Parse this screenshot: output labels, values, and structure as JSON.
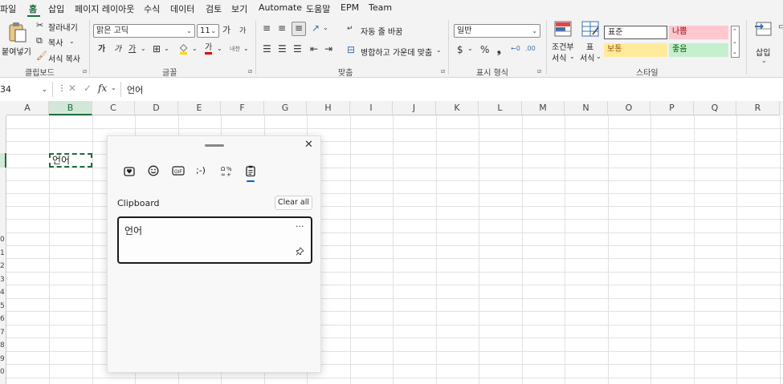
{
  "menu": {
    "file": "파일",
    "home": "홈",
    "insert": "삽입",
    "layout": "페이지 레이아웃",
    "formulas": "수식",
    "data": "데이터",
    "review": "검토",
    "view": "보기",
    "automate": "Automate",
    "help": "도움말",
    "epm": "EPM",
    "team": "Team"
  },
  "ribbon": {
    "clipboard": {
      "paste": "붙여넣기",
      "cut": "잘라내기",
      "copy": "복사",
      "format_painter": "서식 복사",
      "label": "클립보드"
    },
    "font": {
      "name": "맑은 고딕",
      "size": "11",
      "grow": "가",
      "shrink": "가",
      "bold": "가",
      "italic": "가",
      "underline": "가",
      "font_color_glyph": "가",
      "phonetic": "내천",
      "label": "글꼴"
    },
    "alignment": {
      "wrap_text": "자동 줄 바꿈",
      "merge_center": "병합하고 가운데 맞춤",
      "label": "맞춤"
    },
    "number": {
      "format": "일반",
      "label": "표시 형식"
    },
    "styles": {
      "conditional_l1": "조건부",
      "conditional_l2": "서식",
      "table_l1": "표",
      "table_l2": "서식",
      "normal": "표준",
      "bad": "나쁨",
      "neutral": "보통",
      "good": "좋음",
      "label": "스타일"
    },
    "cells": {
      "insert": "삽입"
    }
  },
  "formula_bar": {
    "name_box": "34",
    "fx": "fx",
    "content": "언어"
  },
  "columns": [
    "A",
    "B",
    "C",
    "D",
    "E",
    "F",
    "G",
    "H",
    "I",
    "J",
    "K",
    "L",
    "M",
    "N",
    "O",
    "P",
    "Q",
    "R"
  ],
  "row_labels": [
    "0",
    "1",
    "2",
    "3",
    "4",
    "5",
    "6",
    "7",
    "8",
    "9",
    "0"
  ],
  "cell": {
    "value": "언어"
  },
  "panel": {
    "title": "Clipboard",
    "clear_all": "Clear all",
    "item_text": "언어",
    "more": "···",
    "kaomoji": ";-)"
  },
  "colors": {
    "accent": "#1e6b3a",
    "selection_blue": "#0067c0",
    "bad_fill": "#ffc7ce",
    "bad_text": "#9c0006",
    "neutral_fill": "#ffeb9c",
    "neutral_text": "#9c5700",
    "good_fill": "#c6efce",
    "good_text": "#006100"
  }
}
